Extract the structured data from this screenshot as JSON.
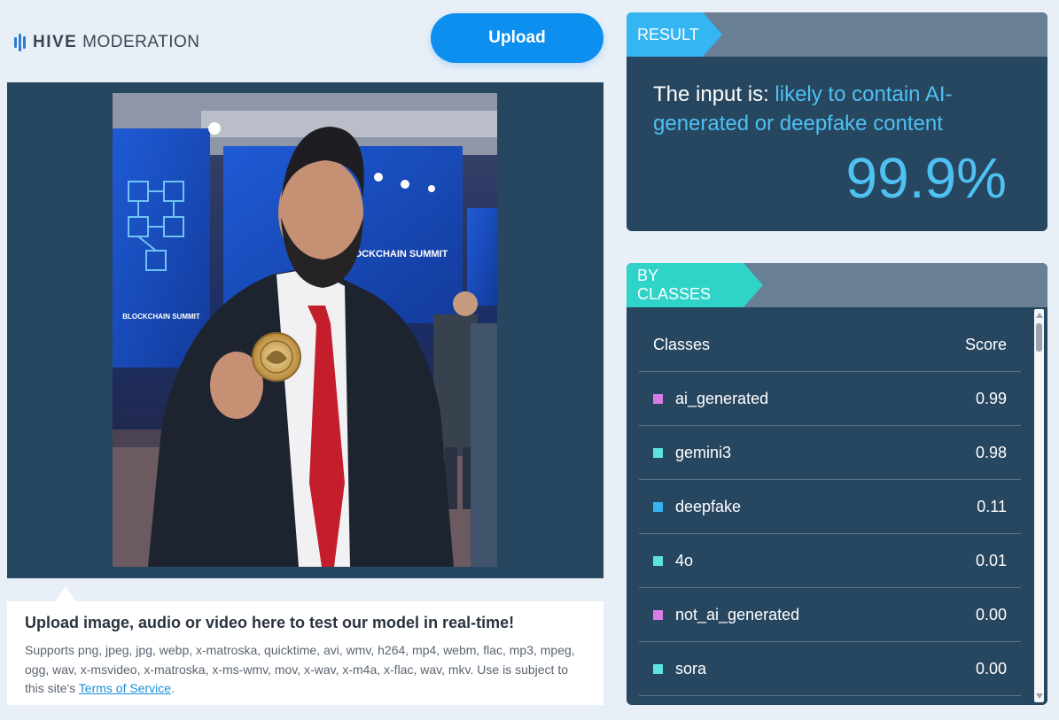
{
  "header": {
    "logo_bold": "HIVE",
    "logo_rest": "MODERATION",
    "upload_label": "Upload"
  },
  "upload_info": {
    "title": "Upload image, audio or video here to test our model in real-time!",
    "supports_text": "Supports png, jpeg, jpg, webp, x-matroska, quicktime, avi, wmv, h264, mp4, webm, flac, mp3, mpeg, ogg, wav, x-msvideo, x-matroska, x-ms-wmv, mov, x-wav, x-m4a, x-flac, wav, mkv. Use is subject to this site's",
    "tos_link": "Terms of Service",
    "period": "."
  },
  "result": {
    "tag": "RESULT",
    "prefix": "The input is: ",
    "verdict": "likely to contain AI-generated or deepfake content",
    "score": "99.9%"
  },
  "classes": {
    "tag": "BY CLASSES",
    "col_class": "Classes",
    "col_score": "Score",
    "rows": [
      {
        "name": "ai_generated",
        "score": "0.99",
        "color": "#d97de6"
      },
      {
        "name": "gemini3",
        "score": "0.98",
        "color": "#5de3e0"
      },
      {
        "name": "deepfake",
        "score": "0.11",
        "color": "#35b6f2"
      },
      {
        "name": "4o",
        "score": "0.01",
        "color": "#5de3e0"
      },
      {
        "name": "not_ai_generated",
        "score": "0.00",
        "color": "#d97de6"
      },
      {
        "name": "sora",
        "score": "0.00",
        "color": "#5de3e0"
      }
    ]
  },
  "photo": {
    "banner_text": "SYRIA BLOCKCHAIN SUMMIT",
    "banner_text_left": "BLOCKCHAIN SUMMIT"
  }
}
